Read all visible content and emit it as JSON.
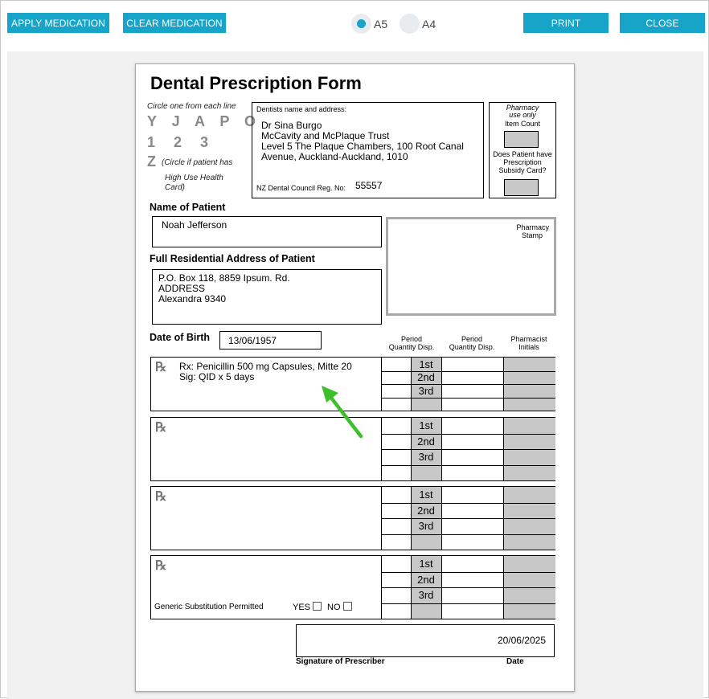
{
  "toolbar": {
    "apply_label": "APPLY MEDICATION",
    "clear_label": "CLEAR MEDICATION",
    "print_label": "PRINT",
    "close_label": "CLOSE",
    "size_options": [
      {
        "label": "A5",
        "selected": true
      },
      {
        "label": "A4",
        "selected": false
      }
    ],
    "accent_color": "#17a4c9"
  },
  "form": {
    "title": "Dental Prescription Form",
    "circle_instruction": "Circle one from each line",
    "line1": "Y J A P O",
    "line2": "1 2 3",
    "line3": "Z",
    "line3_note": "(Circle if patient has",
    "line3_note2": "High Use Health",
    "line3_note3": "Card)",
    "dentist": {
      "heading": "Dentists name and address:",
      "name": "Dr Sina Burgo",
      "org": "McCavity and McPlaque Trust",
      "address1": "Level 5 The Plaque Chambers, 100 Root Canal",
      "address2": "Avenue, Auckland-Auckland, 1010",
      "reg_label": "NZ Dental Council Reg. No:",
      "reg_no": "55557"
    },
    "pharmacy_use": {
      "heading1": "Pharmacy",
      "heading2": "use only",
      "item_count": "Item Count",
      "subsidy_q1": "Does Patient have",
      "subsidy_q2": "Prescription",
      "subsidy_q3": "Subsidy Card?"
    },
    "patient_name_label": "Name of Patient",
    "patient_name": "Noah Jefferson",
    "address_label": "Full Residential Address of Patient",
    "address_lines": [
      "P.O. Box 118, 8859 Ipsum. Rd.",
      "ADDRESS",
      "Alexandra 9340"
    ],
    "pharmacy_stamp1": "Pharmacy",
    "pharmacy_stamp2": "Stamp",
    "dob_label": "Date of Birth",
    "dob": "13/06/1957",
    "col_headers": {
      "period1": "Period",
      "qty1": "Quantity Disp.",
      "period2": "Period",
      "qty2": "Quantity Disp.",
      "pharm1": "Pharmacist",
      "pharm2": "Initials"
    },
    "rx_symbol": "℞",
    "ordinals": [
      "1st",
      "2nd",
      "3rd"
    ],
    "rx_blocks": [
      {
        "line1": "Rx: Penicillin 500 mg Capsules, Mitte 20",
        "line2": "Sig: QID x 5 days"
      },
      {
        "line1": "",
        "line2": ""
      },
      {
        "line1": "",
        "line2": ""
      },
      {
        "line1": "",
        "line2": ""
      }
    ],
    "generic_label": "Generic Substitution Permitted",
    "yes_label": "YES",
    "no_label": "NO",
    "signature_date": "20/06/2025",
    "signature_label": "Signature of Prescriber",
    "date_label": "Date"
  },
  "annotation": {
    "arrow_color": "#3cbf2a",
    "arrow_icon": "green-arrow-icon"
  }
}
